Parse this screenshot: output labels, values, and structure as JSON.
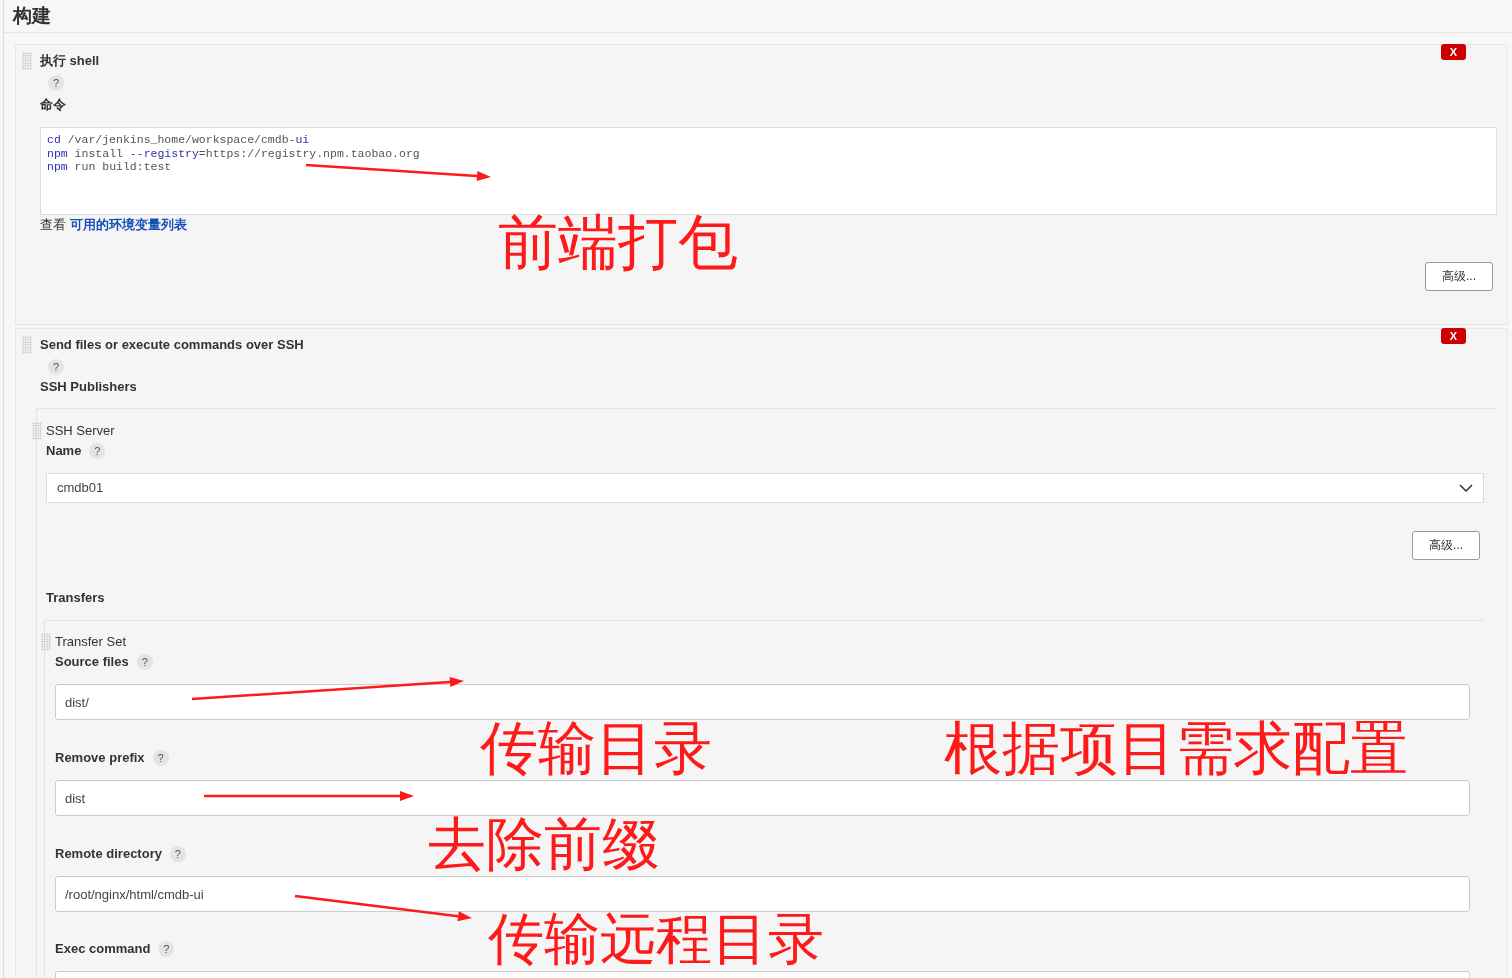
{
  "page_title": "构建",
  "builders": [
    {
      "kind": "shell",
      "title": "执行 shell",
      "delete_label": "X",
      "help": "?",
      "command_label": "命令",
      "command_lines": [
        [
          {
            "kind": "keyword",
            "text": "cd"
          },
          {
            "kind": "plain",
            "text": " /var/jenkins_home/workspace/cmdb-"
          },
          {
            "kind": "keyword",
            "text": "ui"
          }
        ],
        [
          {
            "kind": "keyword",
            "text": "npm"
          },
          {
            "kind": "plain",
            "text": " install "
          },
          {
            "kind": "keyword",
            "text": "--registry"
          },
          {
            "kind": "plain",
            "text": "=https://registry.npm.taobao.org"
          }
        ],
        [
          {
            "kind": "keyword",
            "text": "npm"
          },
          {
            "kind": "plain",
            "text": " run build:test"
          }
        ]
      ],
      "env_prefix": "查看",
      "env_link": "可用的环境变量列表",
      "advanced_button": "高级..."
    },
    {
      "kind": "ssh",
      "title": "Send files or execute commands over SSH",
      "delete_label": "X",
      "help": "?",
      "publishers_label": "SSH Publishers",
      "server": {
        "heading": "SSH Server",
        "name_label": "Name",
        "help": "?",
        "name_value": "cmdb01",
        "advanced_button": "高级..."
      },
      "transfers_label": "Transfers",
      "transfer_set": {
        "heading": "Transfer Set",
        "fields": [
          {
            "label": "Source files",
            "help": "?",
            "value": "dist/"
          },
          {
            "label": "Remove prefix",
            "help": "?",
            "value": "dist"
          },
          {
            "label": "Remote directory",
            "help": "?",
            "value": "/root/nginx/html/cmdb-ui"
          },
          {
            "label": "Exec command",
            "help": "?"
          }
        ]
      }
    }
  ],
  "annotations": [
    {
      "text": "前端打包"
    },
    {
      "text": "传输目录"
    },
    {
      "text": "根据项目需求配置"
    },
    {
      "text": "去除前缀"
    },
    {
      "text": "传输远程目录"
    }
  ]
}
